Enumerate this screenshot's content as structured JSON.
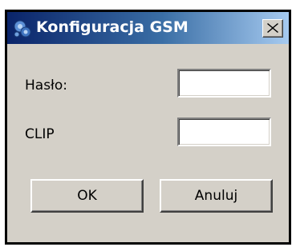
{
  "window": {
    "title": "Konfiguracja GSM",
    "close_icon": "close-icon",
    "app_icon": "gsm-gears-icon"
  },
  "form": {
    "password_label": "Hasło:",
    "password_value": "",
    "clip_label": "CLIP",
    "clip_value": ""
  },
  "buttons": {
    "ok_label": "OK",
    "cancel_label": "Anuluj"
  },
  "colors": {
    "titlebar_start": "#0a246a",
    "titlebar_end": "#a6caf0",
    "dialog_face": "#d4d0c8"
  }
}
